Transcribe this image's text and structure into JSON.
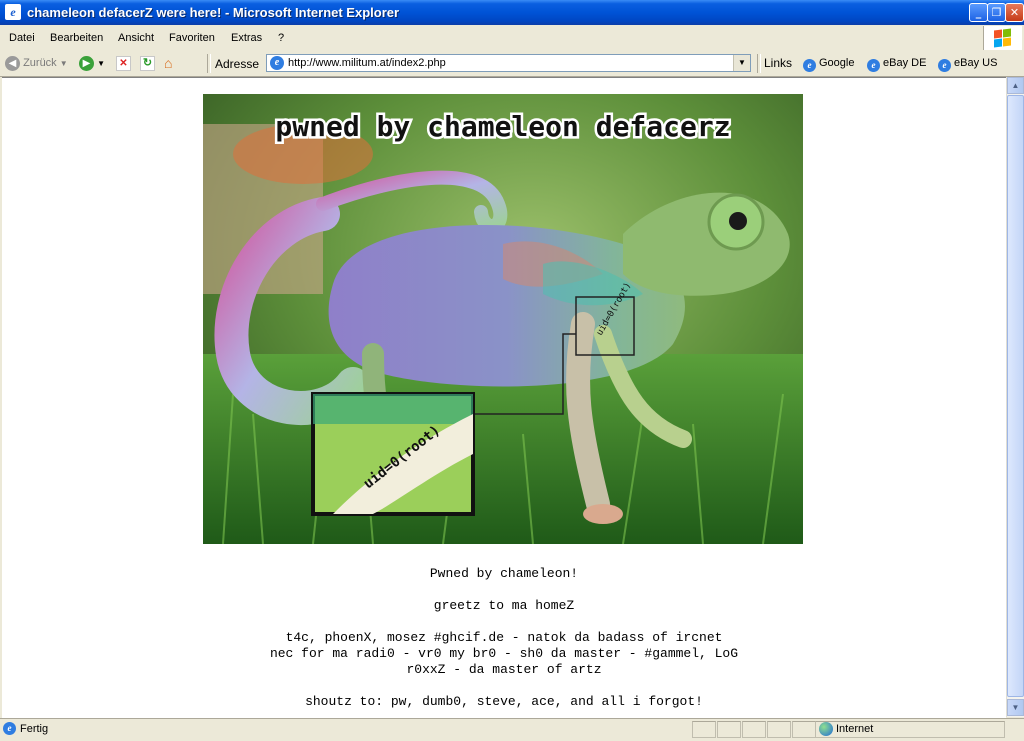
{
  "window": {
    "title": "chameleon defacerZ were here! - Microsoft Internet Explorer",
    "minimize": "_",
    "maximize": "❐",
    "close": "✕"
  },
  "menu": {
    "items": [
      "Datei",
      "Bearbeiten",
      "Ansicht",
      "Favoriten",
      "Extras",
      "?"
    ]
  },
  "toolbar": {
    "back_label": "Zurück",
    "address_label": "Adresse",
    "url": "http://www.militum.at/index2.php",
    "links_label": "Links",
    "links": [
      "Google",
      "eBay DE",
      "eBay US"
    ]
  },
  "page": {
    "hero_caption": "pwned by chameleon defacerz",
    "hero_tag": "uid=0(root)",
    "line1": "Pwned by chameleon!",
    "line2": "greetz to ma homeZ",
    "line3": "t4c, phoenX, mosez #ghcif.de - natok da badass of ircnet",
    "line4": "nec for ma radi0 - vr0 my br0 - sh0 da master - #gammel, LoG",
    "line5": "r0xxZ - da master of artz",
    "line6": "shoutz to: pw, dumb0, steve, ace, and all i forgot!"
  },
  "status": {
    "text": "Fertig",
    "zone": "Internet"
  },
  "colors": {
    "title_bar": "#0053d6",
    "chrome": "#ece9d8",
    "grass": "#3f8a2a",
    "chameleon_body": "#8a86c6"
  }
}
